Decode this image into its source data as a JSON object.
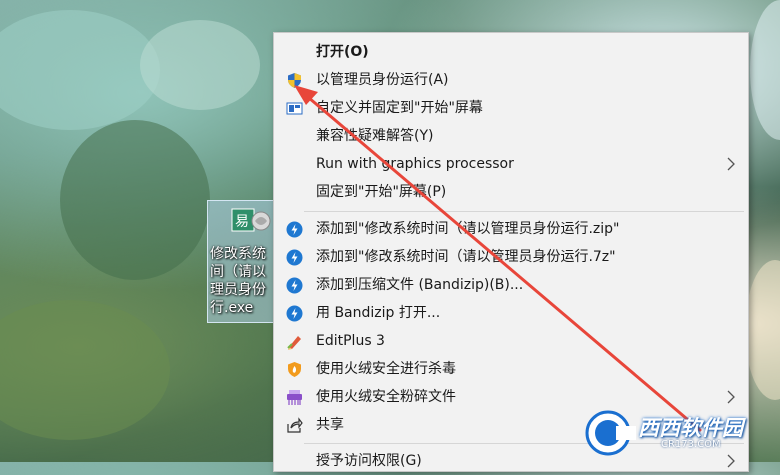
{
  "desktop": {
    "file_icon_label": "修改系统\n间（请以\n理员身份\n行.exe"
  },
  "context_menu": {
    "items": [
      {
        "label": "打开(O)",
        "icon": "none",
        "bold": true
      },
      {
        "label": "以管理员身份运行(A)",
        "icon": "uac-shield-icon"
      },
      {
        "label": "自定义并固定到\"开始\"屏幕",
        "icon": "pin-start-icon"
      },
      {
        "label": "兼容性疑难解答(Y)",
        "icon": "none"
      },
      {
        "label": "Run with graphics processor",
        "icon": "none",
        "submenu": true
      },
      {
        "label": "固定到\"开始\"屏幕(P)",
        "icon": "none"
      },
      {
        "label": "添加到\"修改系统时间（请以管理员身份运行.zip\"",
        "icon": "bandizip-icon"
      },
      {
        "label": "添加到\"修改系统时间（请以管理员身份运行.7z\"",
        "icon": "bandizip-icon"
      },
      {
        "label": "添加到压缩文件 (Bandizip)(B)...",
        "icon": "bandizip-icon"
      },
      {
        "label": "用 Bandizip 打开...",
        "icon": "bandizip-icon"
      },
      {
        "label": "EditPlus 3",
        "icon": "editplus-icon"
      },
      {
        "label": "使用火绒安全进行杀毒",
        "icon": "huorong-shield-icon"
      },
      {
        "label": "使用火绒安全粉碎文件",
        "icon": "shredder-icon",
        "submenu": true
      },
      {
        "label": "共享",
        "icon": "share-icon"
      },
      {
        "label": "授予访问权限(G)",
        "icon": "none",
        "submenu": true
      }
    ]
  },
  "watermark": {
    "main": "西西软件园",
    "sub": "CR173.COM"
  },
  "colors": {
    "menu_bg": "#f2f2f2",
    "annotation_arrow": "#e8463a",
    "bandizip_blue": "#1f78d1"
  }
}
